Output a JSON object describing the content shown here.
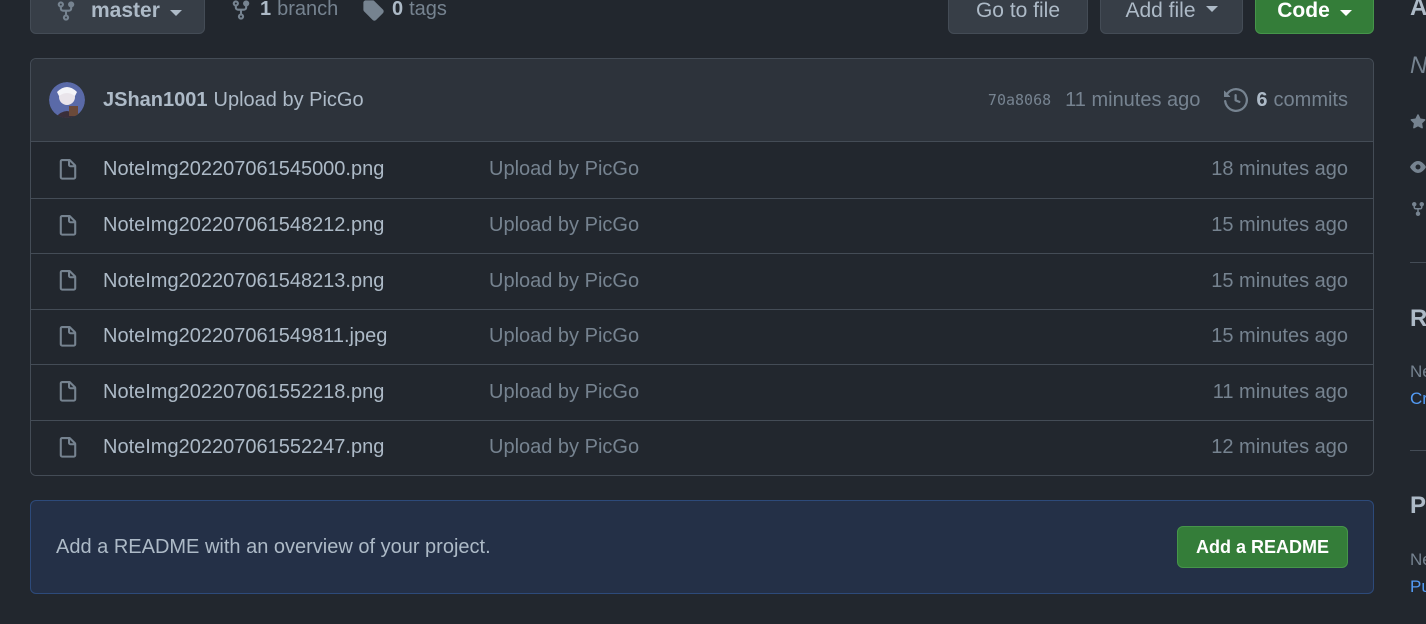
{
  "toolbar": {
    "branch_name": "master",
    "branch_count": "1",
    "branch_label": "branch",
    "tag_count": "0",
    "tag_label": "tags",
    "goto_label": "Go to file",
    "addfile_label": "Add file",
    "code_label": "Code"
  },
  "commit": {
    "author": "JShan1001",
    "message": "Upload by PicGo",
    "sha": "70a8068",
    "when": "11 minutes ago",
    "commit_count": "6",
    "commit_label": "commits"
  },
  "files": [
    {
      "name": "NoteImg202207061545000.png",
      "message": "Upload by PicGo",
      "age": "18 minutes ago"
    },
    {
      "name": "NoteImg202207061548212.png",
      "message": "Upload by PicGo",
      "age": "15 minutes ago"
    },
    {
      "name": "NoteImg202207061548213.png",
      "message": "Upload by PicGo",
      "age": "15 minutes ago"
    },
    {
      "name": "NoteImg202207061549811.jpeg",
      "message": "Upload by PicGo",
      "age": "15 minutes ago"
    },
    {
      "name": "NoteImg202207061552218.png",
      "message": "Upload by PicGo",
      "age": "11 minutes ago"
    },
    {
      "name": "NoteImg202207061552247.png",
      "message": "Upload by PicGo",
      "age": "12 minutes ago"
    }
  ],
  "readme": {
    "text": "Add a README with an overview of your project.",
    "button_label": "Add a README"
  },
  "sidebar": {
    "about_heading_partial": "A",
    "about_text_partial": "N",
    "releases_heading_partial": "R",
    "releases_text_partial": "Ne",
    "releases_link_partial": "Cr",
    "packages_heading_partial": "Pa",
    "packages_text_partial": "Ne",
    "packages_link_partial": "Pu"
  },
  "colors": {
    "background": "#22272e",
    "accent_green": "#347d39",
    "link_blue": "#539bf5",
    "readme_bg": "#243047"
  }
}
